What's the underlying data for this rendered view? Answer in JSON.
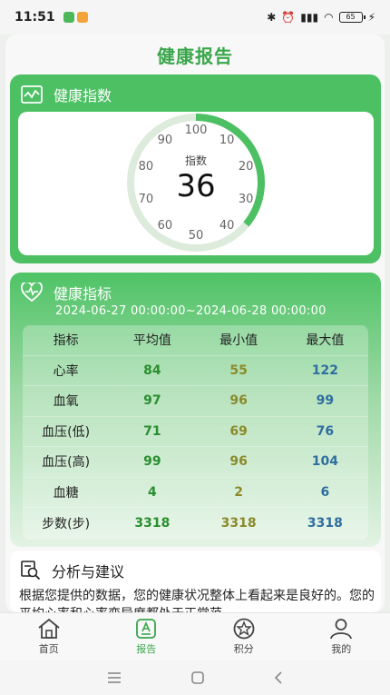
{
  "status": {
    "time": "11:51",
    "battery": "65"
  },
  "page": {
    "title": "健康报告"
  },
  "index_card": {
    "title": "健康指数",
    "center_label": "指数",
    "value": "36",
    "value_number": 36,
    "ticks": [
      "100",
      "10",
      "20",
      "30",
      "40",
      "50",
      "60",
      "70",
      "80",
      "90"
    ]
  },
  "metrics": {
    "title": "健康指标",
    "date_range": "2024-06-27 00:00:00~2024-06-28 00:00:00",
    "headers": [
      "指标",
      "平均值",
      "最小值",
      "最大值"
    ],
    "rows": [
      {
        "label": "心率",
        "avg": "84",
        "min": "55",
        "max": "122"
      },
      {
        "label": "血氧",
        "avg": "97",
        "min": "96",
        "max": "99"
      },
      {
        "label": "血压(低)",
        "avg": "71",
        "min": "69",
        "max": "76"
      },
      {
        "label": "血压(高)",
        "avg": "99",
        "min": "96",
        "max": "104"
      },
      {
        "label": "血糖",
        "avg": "4",
        "min": "2",
        "max": "6"
      },
      {
        "label": "步数(步)",
        "avg": "3318",
        "min": "3318",
        "max": "3318"
      }
    ]
  },
  "analysis": {
    "title": "分析与建议",
    "text": "根据您提供的数据，您的健康状况整体上看起来是良好的。您的平均心率和心率变异度都处于正常范"
  },
  "tabs": [
    {
      "label": "首页",
      "icon": "home-icon"
    },
    {
      "label": "报告",
      "icon": "report-icon",
      "active": true
    },
    {
      "label": "积分",
      "icon": "points-icon"
    },
    {
      "label": "我的",
      "icon": "user-icon"
    }
  ],
  "colors": {
    "accent": "#4cc063",
    "title": "#3aa64c"
  }
}
